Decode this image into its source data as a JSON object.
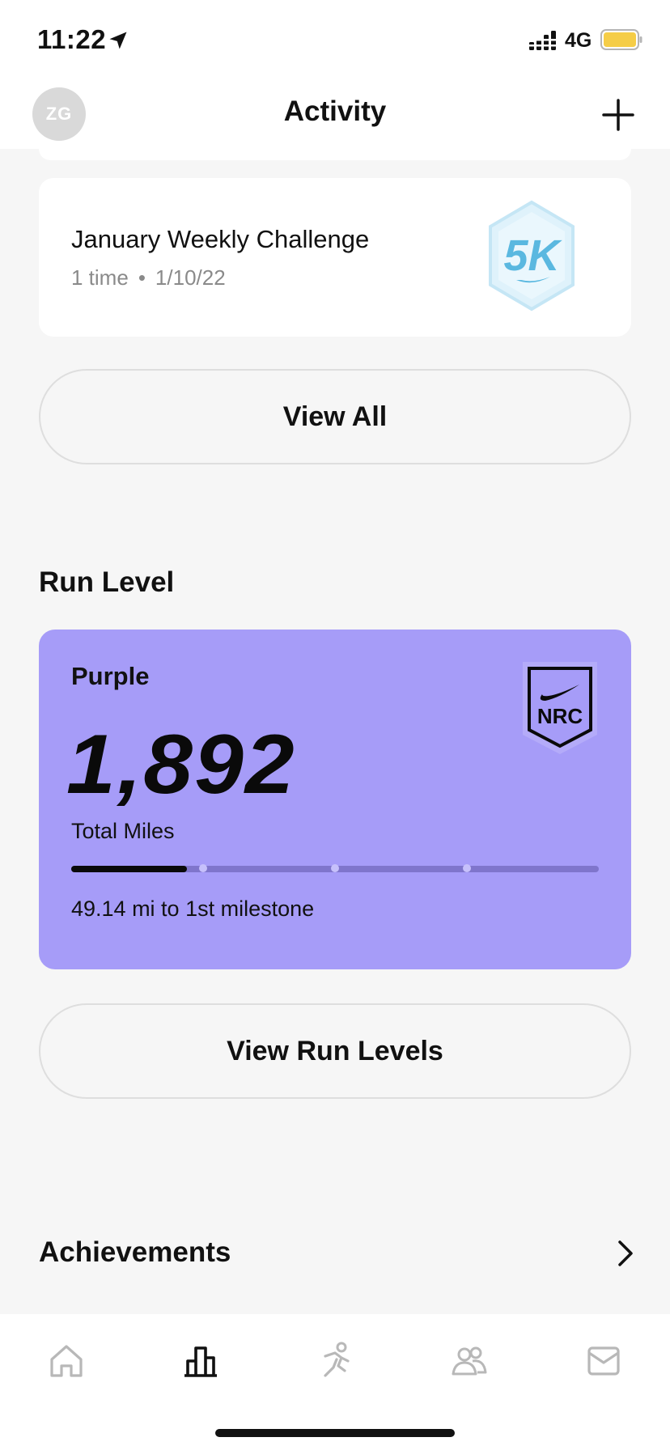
{
  "status_bar": {
    "time": "11:22",
    "network": "4G",
    "icons": [
      "location-arrow-icon",
      "signal-icon",
      "battery-icon"
    ],
    "battery_color": "#f5cd47"
  },
  "header": {
    "avatar_initials": "ZG",
    "title": "Activity",
    "add_icon": "plus-icon"
  },
  "challenge_card": {
    "title": "January Weekly Challenge",
    "count": "1 time",
    "separator": "•",
    "date": "1/10/22",
    "badge_text": "5K",
    "badge_color": "#5ab8e0"
  },
  "buttons": {
    "view_all": "View All",
    "view_run_levels": "View Run Levels"
  },
  "run_level": {
    "section_title": "Run Level",
    "level_name": "Purple",
    "total_miles": "1,892",
    "total_miles_label": "Total Miles",
    "progress_fraction": 0.22,
    "milestone_fractions": [
      0.25,
      0.5,
      0.75
    ],
    "milestone_text": "49.14 mi to 1st milestone",
    "badge_text": "NRC",
    "card_color": "#a69cf8"
  },
  "achievements": {
    "section_title": "Achievements"
  },
  "tab_bar": {
    "tabs": [
      {
        "name": "home",
        "icon": "home-icon",
        "active": false
      },
      {
        "name": "activity",
        "icon": "bar-chart-icon",
        "active": true
      },
      {
        "name": "run",
        "icon": "runner-icon",
        "active": false
      },
      {
        "name": "club",
        "icon": "people-icon",
        "active": false
      },
      {
        "name": "inbox",
        "icon": "inbox-icon",
        "active": false
      }
    ]
  }
}
